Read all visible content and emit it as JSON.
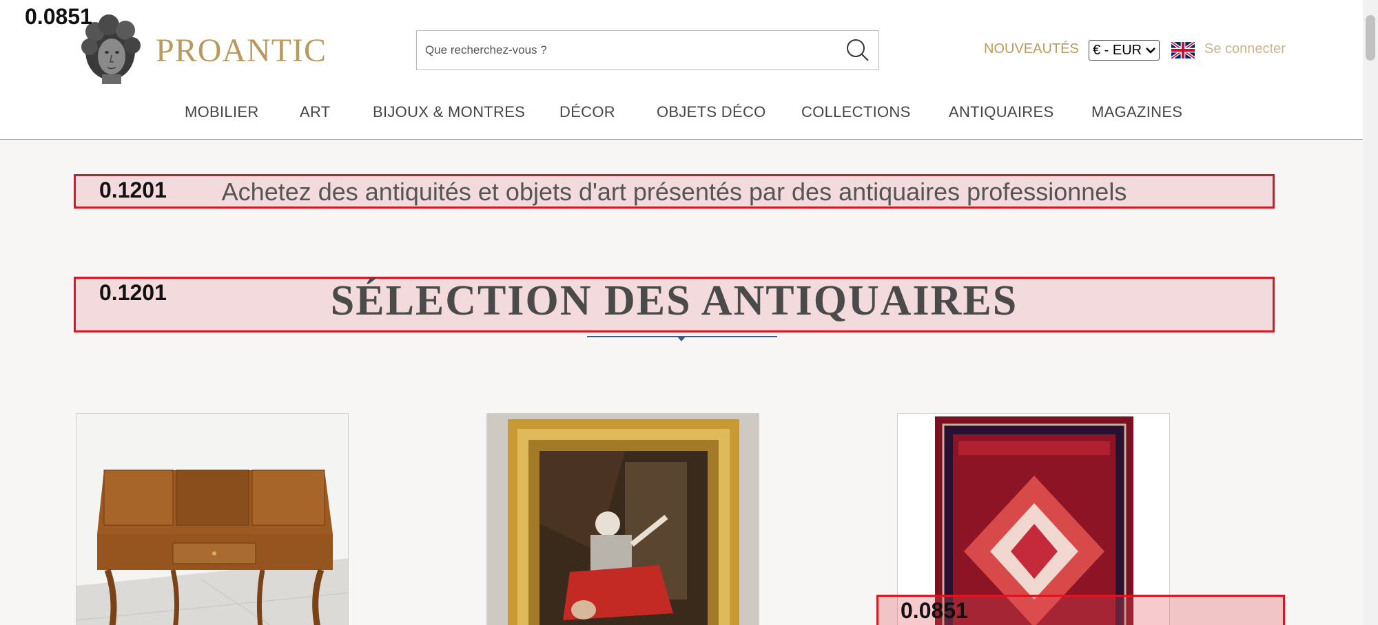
{
  "header": {
    "brand": "PROANTIC",
    "search": {
      "placeholder": "Que recherchez-vous ?"
    },
    "nouveautes_label": "NOUVEAUTÉS",
    "currency_selected": "€ - EUR",
    "login_label": "Se connecter",
    "overlay_score": "0.0851"
  },
  "nav": {
    "items": [
      "MOBILIER",
      "ART",
      "BIJOUX & MONTRES",
      "DÉCOR",
      "OBJETS DÉCO",
      "COLLECTIONS",
      "ANTIQUAIRES",
      "MAGAZINES"
    ]
  },
  "main": {
    "tagline": "Achetez des antiquités et objets d'art présentés par des antiquaires professionnels",
    "tagline_score": "0.1201",
    "section_title": "SÉLECTION DES ANTIQUAIRES",
    "section_score": "0.1201",
    "card3_score": "0.0851"
  },
  "colors": {
    "brand": "#b89a5c",
    "highlight_border": "#e0141e",
    "rule": "#3d5a7a"
  },
  "icons": [
    "bust-logo-icon",
    "search-icon",
    "chevron-down-icon",
    "uk-flag-icon"
  ]
}
